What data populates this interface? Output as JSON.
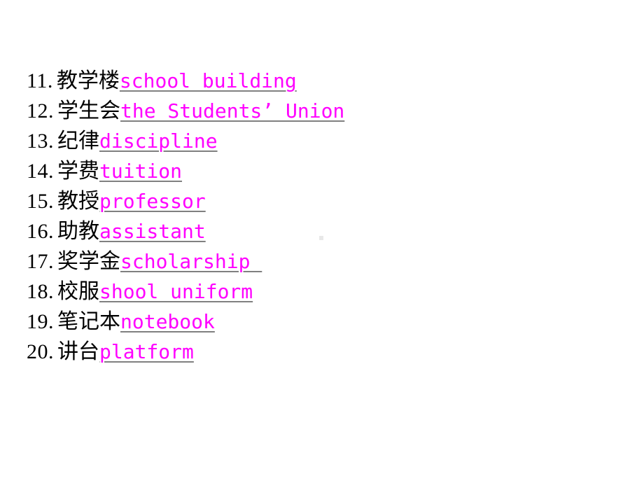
{
  "slide": {
    "background_color": "#ffffff",
    "text_color": "#000000",
    "english_color": "#ff00ff",
    "underline_color": "#808080",
    "artifact_color": "#e8e8e8"
  },
  "vocab_list": [
    {
      "number": "11.",
      "chinese": "教学楼",
      "english": "school building"
    },
    {
      "number": "12.",
      "chinese": "学生会",
      "english": "the Students’ Union"
    },
    {
      "number": "13.",
      "chinese": "纪律",
      "english": "discipline"
    },
    {
      "number": "14.",
      "chinese": "学费",
      "english": "tuition"
    },
    {
      "number": "15.",
      "chinese": "教授",
      "english": "professor"
    },
    {
      "number": "16.",
      "chinese": "助教",
      "english": "assistant"
    },
    {
      "number": "17.",
      "chinese": "奖学金",
      "english": "scholarship "
    },
    {
      "number": "18.",
      "chinese": "校服",
      "english": "shool uniform"
    },
    {
      "number": "19.",
      "chinese": "笔记本",
      "english": "notebook"
    },
    {
      "number": "20.",
      "chinese": "讲台",
      "english": "platform"
    }
  ]
}
